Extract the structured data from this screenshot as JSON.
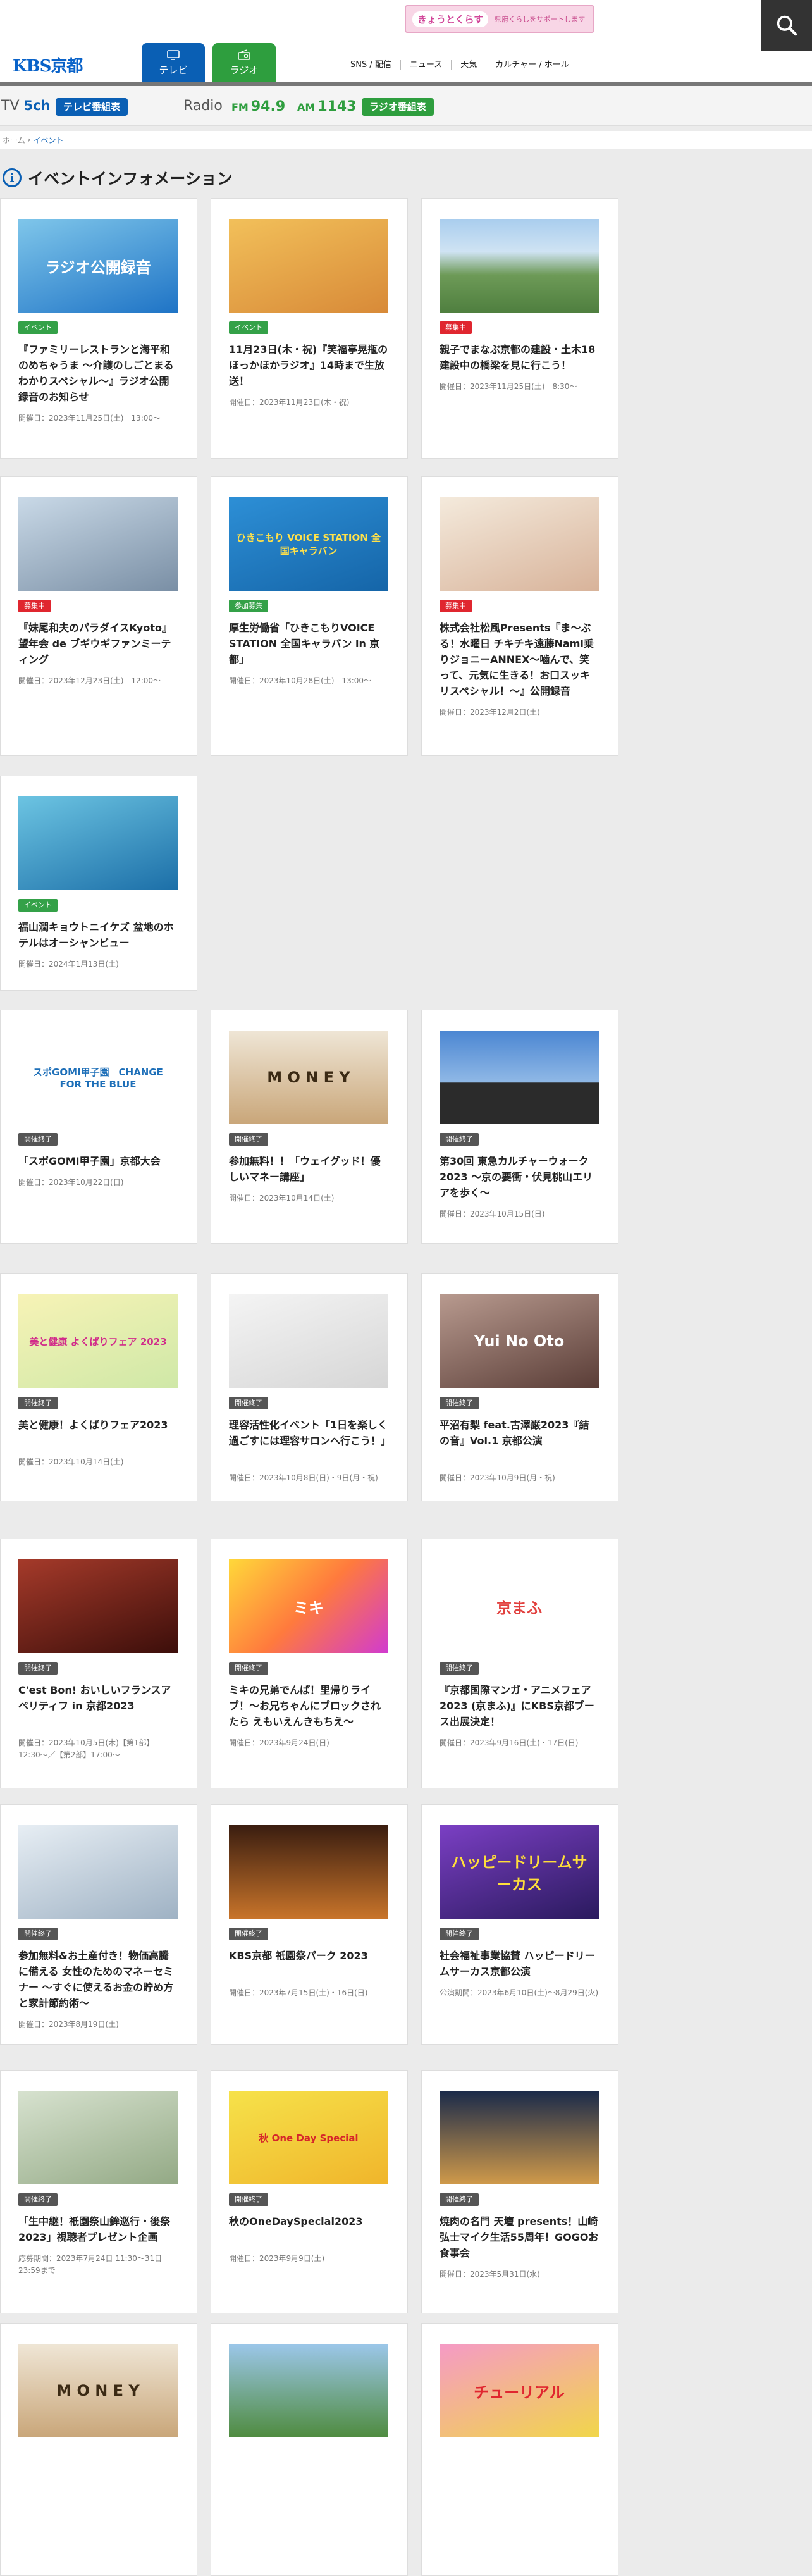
{
  "header": {
    "brand": "KBS京都",
    "ad_main": "きょうとくらす",
    "ad_sub": "県府くらしをサポートします",
    "tabs": {
      "tv": "テレビ",
      "radio": "ラジオ"
    },
    "nav": [
      "SNS / 配信",
      "ニュース",
      "天気",
      "カルチャー / ホール"
    ]
  },
  "channel_bar": {
    "tv_label": "TV",
    "tv_channel": "5ch",
    "tv_schedule": "テレビ番組表",
    "radio_label": "Radio",
    "fm_band": "FM",
    "fm_freq": "94.9",
    "am_band": "AM",
    "am_freq": "1143",
    "radio_schedule": "ラジオ番組表"
  },
  "breadcrumb": {
    "home": "ホーム",
    "sep": "›",
    "current": "イベント"
  },
  "page_title": "イベントインフォメーション",
  "badge_colors": {
    "イベント": "#34a148",
    "募集中": "#e0262f",
    "参加募集": "#34a148",
    "開催終了": "#555555"
  },
  "cards": [
    {
      "badge": "イベント",
      "title": "『ファミリーレストランと海平和のめちゃうま 〜介護のしごとまるわかりスペシャル〜』ラジオ公開録音のお知らせ",
      "date": "開催日：2023年11月25日(土)　13:00〜",
      "thumb_text": "ラジオ公開録音",
      "thumb_bg": "linear-gradient(160deg,#7fc6ea,#1f74c6)",
      "thumb_fg": "#ffffff"
    },
    {
      "badge": "イベント",
      "title": "11月23日(木・祝)『笑福亭晃瓶のほっかほかラジオ』14時まで生放送！",
      "date": "開催日：2023年11月23日(木・祝)",
      "thumb_text": "",
      "thumb_bg": "linear-gradient(160deg,#f2c05a,#d88a38)",
      "thumb_fg": "#ffffff"
    },
    {
      "badge": "募集中",
      "title": "親子でまなぶ京都の建設・土木18 建設中の橋梁を見に行こう！",
      "date": "開催日：2023年11月25日(土)　8:30〜",
      "thumb_text": "",
      "thumb_bg": "linear-gradient(180deg,#a9cdee 0%,#cfe3f3 35%,#6d9a57 60%,#4f7f3f 100%)",
      "thumb_fg": "#ffffff"
    },
    {
      "badge": "募集中",
      "title": "『妹尾和夫のパラダイスKyoto』望年会 de ブギウギファンミーティング",
      "date": "開催日：2023年12月23日(土)　12:00〜",
      "thumb_text": "",
      "thumb_bg": "linear-gradient(160deg,#c9d9e7,#7a8fa5)",
      "thumb_fg": "#ffffff"
    },
    {
      "badge": "参加募集",
      "title": "厚生労働省「ひきこもりVOICE STATION 全国キャラバン in 京都」",
      "date": "開催日：2023年10月28日(土)　13:00〜",
      "thumb_text": "ひきこもり VOICE STATION 全国キャラバン",
      "thumb_bg": "linear-gradient(160deg,#2d8fd6,#1565a8)",
      "thumb_fg": "#ffe14a"
    },
    {
      "badge": "募集中",
      "title": "株式会社松風Presents『ま〜ぶる！水曜日 チキチキ遠藤Nami乗りジョニーANNEX〜嚙んで、笑って、元気に生きる！お口スッキリスペシャル！〜』公開録音",
      "date": "開催日：2023年12月2日(土)",
      "thumb_text": "",
      "thumb_bg": "linear-gradient(160deg,#f4eadc,#d8b39a)",
      "thumb_fg": "#ffffff"
    },
    {
      "badge": "イベント",
      "title": "福山潤キョウトニイケズ 盆地のホテルはオーシャンビュー",
      "date": "開催日：2024年1月13日(土)",
      "thumb_text": "",
      "thumb_bg": "linear-gradient(160deg,#6cc4e2,#1c6fa8)",
      "thumb_fg": "#ffffff"
    },
    {
      "badge": "開催終了",
      "title": "「スポGOMI甲子園」京都大会",
      "date": "開催日：2023年10月22日(日)",
      "thumb_text": "スポGOMI甲子園　CHANGE FOR THE BLUE",
      "thumb_bg": "#ffffff",
      "thumb_fg": "#1e6fb8"
    },
    {
      "badge": "開催終了",
      "title": "参加無料！！「ウェイグッド！優しいマネー講座」",
      "date": "開催日：2023年10月14日(土)",
      "thumb_text": "M O N E Y",
      "thumb_bg": "linear-gradient(180deg,#efe6d6,#c9a679)",
      "thumb_fg": "#3b2a14"
    },
    {
      "badge": "開催終了",
      "title": "第30回 東急カルチャーウォーク2023 〜京の要衝・伏見桃山エリアを歩く〜",
      "date": "開催日：2023年10月15日(日)",
      "thumb_text": "",
      "thumb_bg": "linear-gradient(180deg,#4b86d2 0%,#8fb8e6 55%,#2b2b2b 56%,#2b2b2b 100%)",
      "thumb_fg": "#ffffff"
    },
    {
      "badge": "開催終了",
      "title": "美と健康！よくばりフェア2023",
      "date": "開催日：2023年10月14日(土)",
      "thumb_text": "美と健康 よくばりフェア 2023",
      "thumb_bg": "linear-gradient(160deg,#f7f3b6,#cfe8a7)",
      "thumb_fg": "#d12a8a"
    },
    {
      "badge": "開催終了",
      "title": "理容活性化イベント「1日を楽しく過ごすには理容サロンへ行こう！」",
      "date": "開催日：2023年10月8日(日)・9日(月・祝)",
      "thumb_text": "",
      "thumb_bg": "linear-gradient(160deg,#f4f4f4,#d6d6d6)",
      "thumb_fg": "#555555"
    },
    {
      "badge": "開催終了",
      "title": "平沼有梨 feat.古澤巌2023『結の音』Vol.1 京都公演",
      "date": "開催日：2023年10月9日(月・祝)",
      "thumb_text": "Yui No Oto",
      "thumb_bg": "linear-gradient(160deg,#b89a8f,#5a3d37)",
      "thumb_fg": "#ffffff"
    },
    {
      "badge": "開催終了",
      "title": "C'est Bon! おいしいフランスアペリティフ in 京都2023",
      "date": "開催日：2023年10月5日(木)【第1部】12:30〜／【第2部】17:00〜",
      "thumb_text": "",
      "thumb_bg": "linear-gradient(160deg,#a53a2a,#3c0e0a)",
      "thumb_fg": "#ffffff"
    },
    {
      "badge": "開催終了",
      "title": "ミキの兄弟でんぱ！里帰りライブ！〜お兄ちゃんにブロックされたら えもいえんきもちえ〜",
      "date": "開催日：2023年9月24日(日)",
      "thumb_text": "ミキ",
      "thumb_bg": "linear-gradient(135deg,#ffd83a,#ff7a3d,#d13bd0)",
      "thumb_fg": "#ffffff"
    },
    {
      "badge": "開催終了",
      "title": "『京都国際マンガ・アニメフェア2023 (京まふ)』にKBS京都ブース出展決定！",
      "date": "開催日：2023年9月16日(土)・17日(日)",
      "thumb_text": "京まふ",
      "thumb_bg": "#ffffff",
      "thumb_fg": "#e2413f"
    },
    {
      "badge": "開催終了",
      "title": "参加無料&お土産付き！物価高騰に備える 女性のためのマネーセミナー 〜すぐに使えるお金の貯め方と家計節約術〜",
      "date": "開催日：2023年8月19日(土)",
      "thumb_text": "",
      "thumb_bg": "linear-gradient(160deg,#e7eef4,#9fb2c4)",
      "thumb_fg": "#ffffff"
    },
    {
      "badge": "開催終了",
      "title": "KBS京都 祇園祭パーク 2023",
      "date": "開催日：2023年7月15日(土)・16日(日)",
      "thumb_text": "",
      "thumb_bg": "linear-gradient(180deg,#3a1d10,#c8742a)",
      "thumb_fg": "#ffffff"
    },
    {
      "badge": "開催終了",
      "title": "社会福祉事業協賛 ハッピードリームサーカス京都公演",
      "date": "公演期間：2023年6月10日(土)〜8月29日(火)",
      "thumb_text": "ハッピードリームサーカス",
      "thumb_bg": "linear-gradient(160deg,#7b3fc4,#2a1a5e)",
      "thumb_fg": "#ffde3a"
    },
    {
      "badge": "開催終了",
      "title": "「生中継！祇園祭山鉾巡行・後祭2023」視聴者プレゼント企画",
      "date": "応募期間：2023年7月24日 11:30〜31日 23:59まで",
      "thumb_text": "",
      "thumb_bg": "linear-gradient(160deg,#d7e2cf,#93a985)",
      "thumb_fg": "#ffffff"
    },
    {
      "badge": "開催終了",
      "title": "秋のOneDaySpecial2023",
      "date": "開催日：2023年9月9日(土)",
      "thumb_text": "秋 One Day Special",
      "thumb_bg": "linear-gradient(160deg,#f6e24a,#f0b52b)",
      "thumb_fg": "#d6262a"
    },
    {
      "badge": "開催終了",
      "title": "焼肉の名門 天壇 presents！山崎弘士マイク生活55周年！GOGOお食事会",
      "date": "開催日：2023年5月31日(水)",
      "thumb_text": "",
      "thumb_bg": "linear-gradient(180deg,#1a2a4a,#d09a4a)",
      "thumb_fg": "#ffffff"
    },
    {
      "badge": "",
      "title": "",
      "date": "",
      "thumb_text": "M O N E Y",
      "thumb_bg": "linear-gradient(180deg,#efe6d6,#c9a679)",
      "thumb_fg": "#3b2a14"
    },
    {
      "badge": "",
      "title": "",
      "date": "",
      "thumb_text": "",
      "thumb_bg": "linear-gradient(180deg,#9cc7ea,#4f8b3f)",
      "thumb_fg": "#ffffff"
    },
    {
      "badge": "",
      "title": "",
      "date": "",
      "thumb_text": "チューリアル",
      "thumb_bg": "linear-gradient(160deg,#f59ac6,#f1d64a)",
      "thumb_fg": "#e0262f"
    }
  ]
}
